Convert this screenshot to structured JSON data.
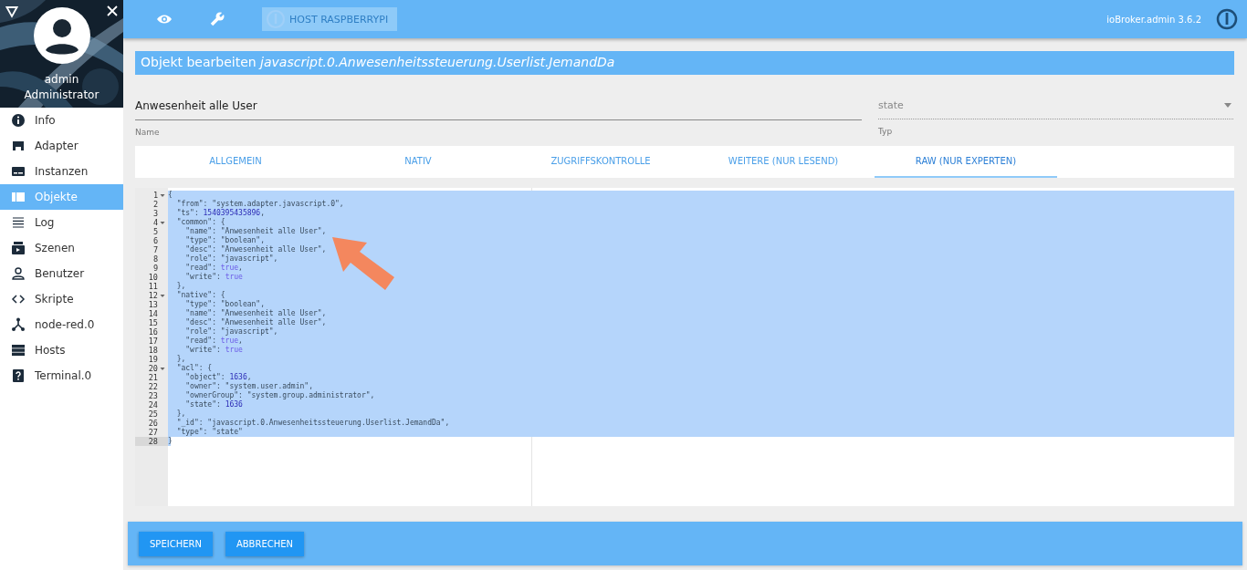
{
  "sidebar": {
    "user": {
      "name": "admin",
      "role": "Administrator"
    },
    "items": [
      {
        "label": "Info",
        "selected": false
      },
      {
        "label": "Adapter",
        "selected": false
      },
      {
        "label": "Instanzen",
        "selected": false
      },
      {
        "label": "Objekte",
        "selected": true
      },
      {
        "label": "Log",
        "selected": false
      },
      {
        "label": "Szenen",
        "selected": false
      },
      {
        "label": "Benutzer",
        "selected": false
      },
      {
        "label": "Skripte",
        "selected": false
      },
      {
        "label": "node-red.0",
        "selected": false
      },
      {
        "label": "Hosts",
        "selected": false
      },
      {
        "label": "Terminal.0",
        "selected": false
      }
    ]
  },
  "toolbar": {
    "host_button": {
      "label": "HOST RASPBERRYPI",
      "disabled": true
    },
    "version": "ioBroker.admin 3.6.2"
  },
  "title": "Objekt bearbeiten *javascript.0.Anwesenheitssteuerung.Userlist.JemandDa*",
  "name_field": {
    "value": "Anwesenheit alle User",
    "label": "Name"
  },
  "type_field": {
    "value": "state",
    "label": "Typ"
  },
  "tabs": [
    {
      "label": "ALLGEMEIN",
      "selected": false
    },
    {
      "label": "NATIV",
      "selected": false
    },
    {
      "label": "ZUGRIFFSKONTROLLE",
      "selected": false
    },
    {
      "label": "WEITERE (NUR LESEND)",
      "selected": false
    },
    {
      "label": "RAW (NUR EXPERTEN)",
      "selected": true
    }
  ],
  "editor": {
    "lines": [
      {
        "number": "1",
        "text": "{",
        "foldable": true
      },
      {
        "number": "2",
        "text": "  \"from\": \"system.adapter.javascript.0\",",
        "foldable": false
      },
      {
        "number": "3",
        "text": "  \"ts\": 1540395435896,",
        "foldable": false
      },
      {
        "number": "4",
        "text": "  \"common\": {",
        "foldable": true
      },
      {
        "number": "5",
        "text": "    \"name\": \"Anwesenheit alle User\",",
        "foldable": false
      },
      {
        "number": "6",
        "text": "    \"type\": \"boolean\",",
        "foldable": false
      },
      {
        "number": "7",
        "text": "    \"desc\": \"Anwesenheit alle User\",",
        "foldable": false
      },
      {
        "number": "8",
        "text": "    \"role\": \"javascript\",",
        "foldable": false
      },
      {
        "number": "9",
        "text": "    \"read\": true,",
        "foldable": false
      },
      {
        "number": "10",
        "text": "    \"write\": true",
        "foldable": false
      },
      {
        "number": "11",
        "text": "  },",
        "foldable": false
      },
      {
        "number": "12",
        "text": "  \"native\": {",
        "foldable": true
      },
      {
        "number": "13",
        "text": "    \"type\": \"boolean\",",
        "foldable": false
      },
      {
        "number": "14",
        "text": "    \"name\": \"Anwesenheit alle User\",",
        "foldable": false
      },
      {
        "number": "15",
        "text": "    \"desc\": \"Anwesenheit alle User\",",
        "foldable": false
      },
      {
        "number": "16",
        "text": "    \"role\": \"javascript\",",
        "foldable": false
      },
      {
        "number": "17",
        "text": "    \"read\": true,",
        "foldable": false
      },
      {
        "number": "18",
        "text": "    \"write\": true",
        "foldable": false
      },
      {
        "number": "19",
        "text": "  },",
        "foldable": false
      },
      {
        "number": "20",
        "text": "  \"acl\": {",
        "foldable": true
      },
      {
        "number": "21",
        "text": "    \"object\": 1636,",
        "foldable": false
      },
      {
        "number": "22",
        "text": "    \"owner\": \"system.user.admin\",",
        "foldable": false
      },
      {
        "number": "23",
        "text": "    \"ownerGroup\": \"system.group.administrator\",",
        "foldable": false
      },
      {
        "number": "24",
        "text": "    \"state\": 1636",
        "foldable": false
      },
      {
        "number": "25",
        "text": "  },",
        "foldable": false
      },
      {
        "number": "26",
        "text": "  \"_id\": \"javascript.0.Anwesenheitssteuerung.Userlist.JemandDa\",",
        "foldable": false
      },
      {
        "number": "27",
        "text": "  \"type\": \"state\"",
        "foldable": false
      },
      {
        "number": "28",
        "text": "}",
        "foldable": false
      }
    ]
  },
  "buttons": [
    {
      "label": "SPEICHERN"
    },
    {
      "label": "ABBRECHEN"
    }
  ]
}
